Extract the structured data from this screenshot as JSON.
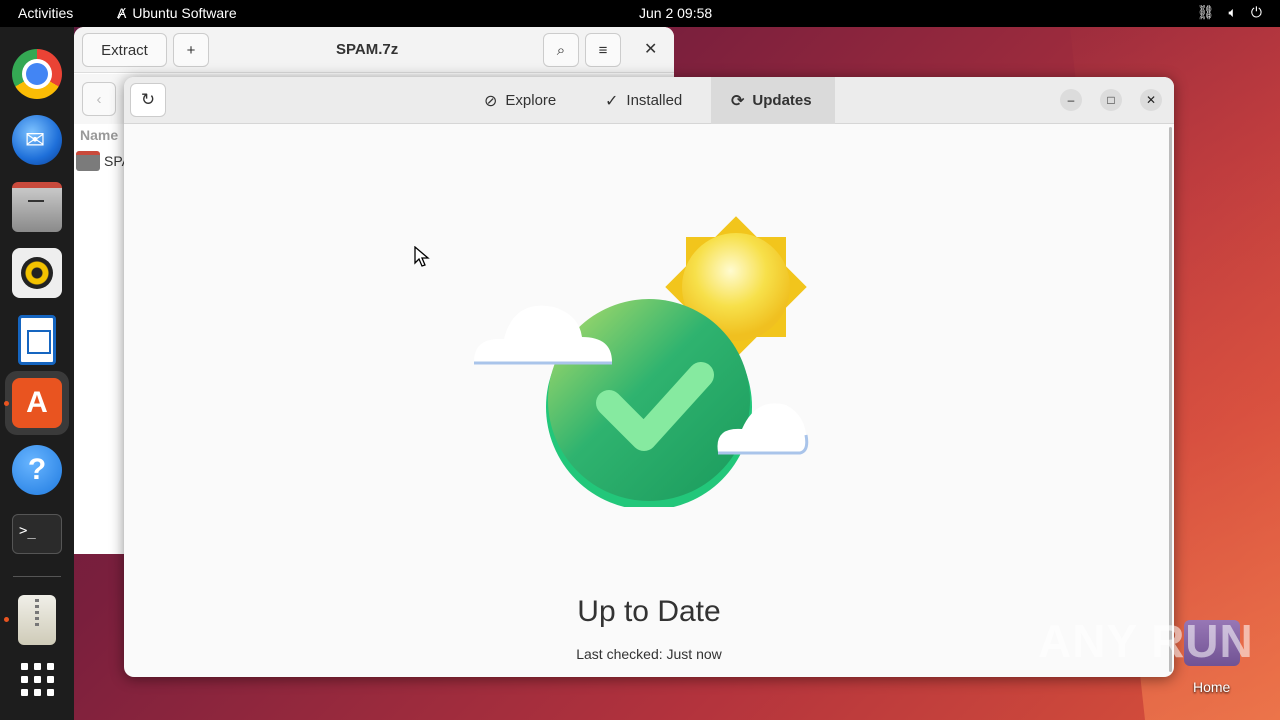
{
  "topbar": {
    "activities": "Activities",
    "app_name": "Ubuntu Software",
    "clock": "Jun 2  09:58"
  },
  "background_window": {
    "extract_label": "Extract",
    "add_label": "+",
    "title": "SPAM.7z",
    "column_name": "Name",
    "row_label": "SPA"
  },
  "main_window": {
    "tabs": [
      {
        "label": "Explore",
        "icon": "compass-icon"
      },
      {
        "label": "Installed",
        "icon": "check-circle-icon"
      },
      {
        "label": "Updates",
        "icon": "sync-icon"
      }
    ],
    "selected_tab": "Updates",
    "status_title": "Up to Date",
    "status_subtitle": "Last checked: Just now"
  },
  "desktop": {
    "home_label": "Home",
    "watermark": "ANY RUN"
  },
  "colors": {
    "accent": "#e95420",
    "check_green": "#2bb673"
  }
}
